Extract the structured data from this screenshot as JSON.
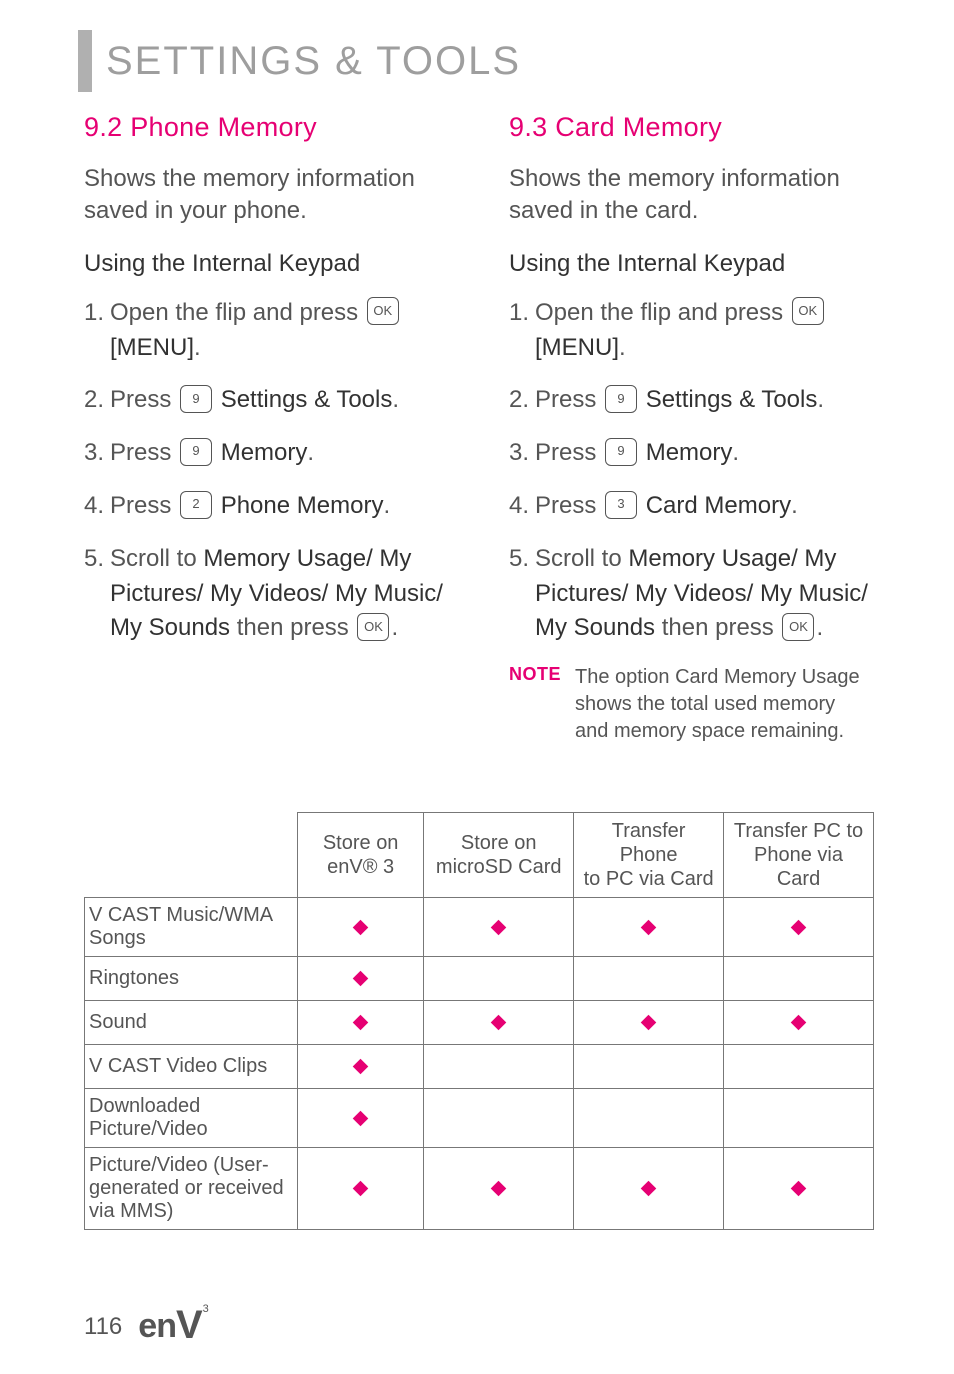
{
  "page_title": "SETTINGS & TOOLS",
  "left": {
    "heading": "9.2 Phone Memory",
    "intro": "Shows the memory information saved in your phone.",
    "subhead": "Using the Internal Keypad",
    "steps": {
      "s1a": "Open the flip and press",
      "s1key": "OK",
      "s1b": "[MENU]",
      "s2a": "Press",
      "s2key": "9",
      "s2b": "Settings & Tools",
      "s3a": "Press",
      "s3key": "9",
      "s3b": "Memory",
      "s4a": "Press",
      "s4key": "2",
      "s4b": "Phone Memory",
      "s5a": "Scroll to",
      "s5b": "Memory Usage/ My Pictures/ My Videos/ My Music/ My Sounds",
      "s5c": "then press",
      "s5key": "OK"
    }
  },
  "right": {
    "heading": "9.3 Card Memory",
    "intro": "Shows the memory information saved in the card.",
    "subhead": "Using the Internal Keypad",
    "steps": {
      "s1a": "Open the flip and press",
      "s1key": "OK",
      "s1b": "[MENU]",
      "s2a": "Press",
      "s2key": "9",
      "s2b": "Settings & Tools",
      "s3a": "Press",
      "s3key": "9",
      "s3b": "Memory",
      "s4a": "Press",
      "s4key": "3",
      "s4b": "Card Memory",
      "s5a": "Scroll to",
      "s5b": "Memory Usage/ My Pictures/ My Videos/ My Music/ My Sounds",
      "s5c": "then press",
      "s5key": "OK"
    },
    "note_label": "NOTE",
    "note_text": "The option Card Memory Usage shows the total used memory and memory space remaining."
  },
  "chart_data": {
    "type": "table",
    "columns": [
      "",
      "Store on enV® 3",
      "Store on microSD Card",
      "Transfer Phone to PC via Card",
      "Transfer PC to Phone via Card"
    ],
    "rows": [
      {
        "label": "V CAST Music/WMA Songs",
        "marks": [
          true,
          true,
          true,
          true
        ]
      },
      {
        "label": "Ringtones",
        "marks": [
          true,
          false,
          false,
          false
        ]
      },
      {
        "label": "Sound",
        "marks": [
          true,
          true,
          true,
          true
        ]
      },
      {
        "label": "V CAST Video Clips",
        "marks": [
          true,
          false,
          false,
          false
        ]
      },
      {
        "label": "Downloaded Picture/Video",
        "marks": [
          true,
          false,
          false,
          false
        ]
      },
      {
        "label": "Picture/Video (User-generated or received via MMS)",
        "marks": [
          true,
          true,
          true,
          true
        ]
      }
    ]
  },
  "table_headers": {
    "c1a": "Store on",
    "c1b": "enV® 3",
    "c2a": "Store on",
    "c2b": "microSD Card",
    "c3a": "Transfer Phone",
    "c3b": "to PC via Card",
    "c4a": "Transfer PC to",
    "c4b": "Phone via Card"
  },
  "table_rows": {
    "r0": "V CAST Music/WMA Songs",
    "r1": "Ringtones",
    "r2": "Sound",
    "r3": "V CAST Video Clips",
    "r4": "Downloaded Picture/Video",
    "r5": "Picture/Video (User-generated or received via MMS)"
  },
  "footer": {
    "page": "116",
    "brand_e": "e",
    "brand_n": "n",
    "brand_V": "V",
    "brand_sup": "3"
  }
}
